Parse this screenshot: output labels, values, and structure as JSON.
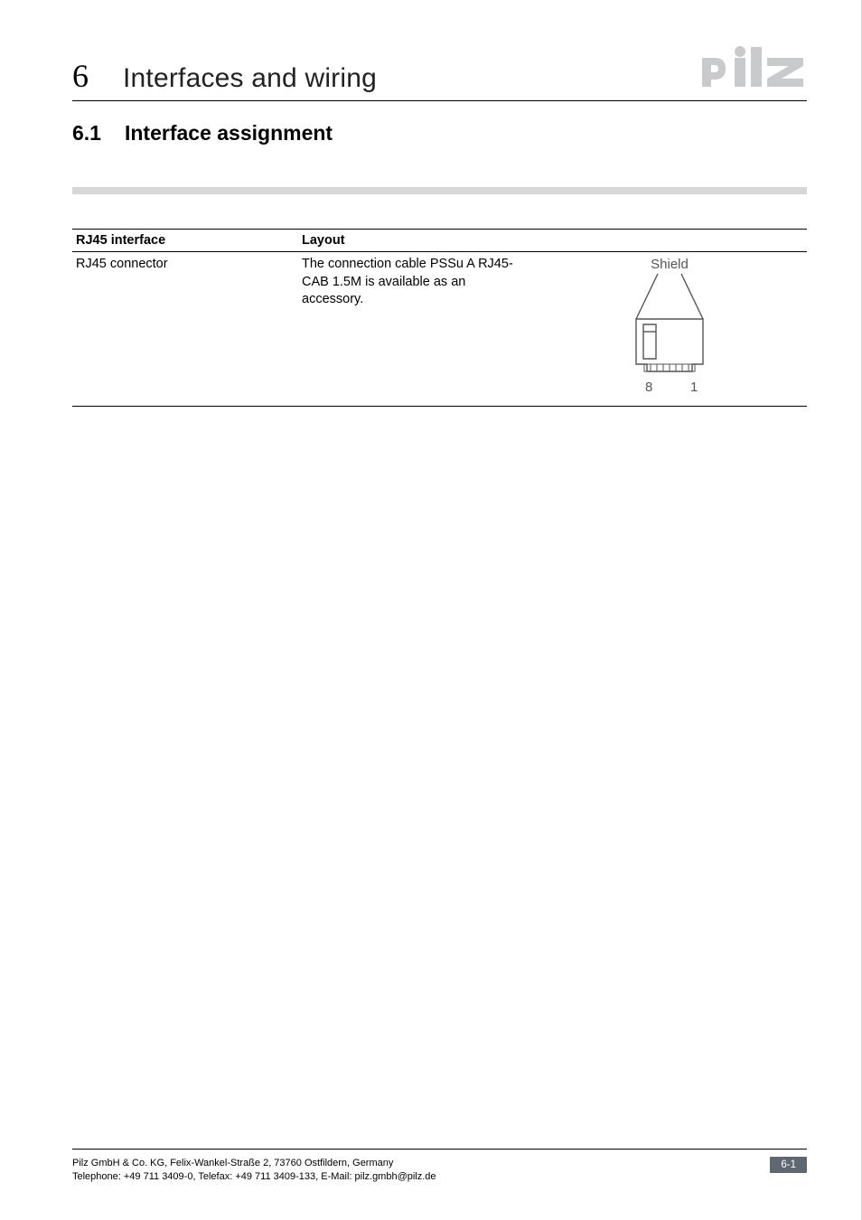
{
  "header": {
    "chapter_number": "6",
    "chapter_title": "Interfaces and wiring"
  },
  "section": {
    "number": "6.1",
    "title": "Interface assignment"
  },
  "table": {
    "headers": {
      "c1": "RJ45 interface",
      "c2": "Layout",
      "c3": ""
    },
    "row": {
      "c1": "RJ45 connector",
      "c2": "The connection cable PSSu A RJ45-CAB 1.5M is available as an accessory.",
      "diagram": {
        "shield_label": "Shield",
        "pin_left": "8",
        "pin_right": "1"
      }
    }
  },
  "footer": {
    "line1": "Pilz GmbH & Co. KG, Felix-Wankel-Straße 2, 73760 Ostfildern, Germany",
    "line2": "Telephone: +49 711 3409-0, Telefax: +49 711 3409-133, E-Mail: pilz.gmbh@pilz.de",
    "page": "6-1"
  }
}
